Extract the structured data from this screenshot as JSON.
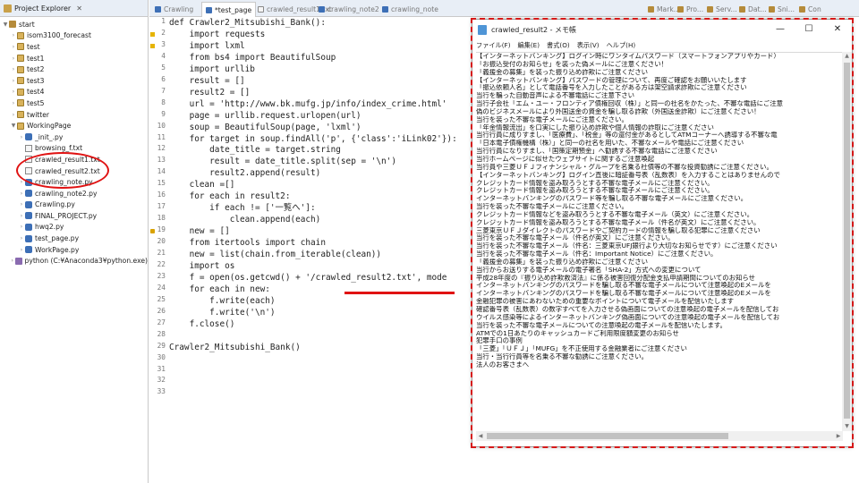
{
  "explorer": {
    "tab_label": "Project Explorer",
    "tree": [
      {
        "label": "start",
        "indent": 0,
        "icon": "project-folder-icon",
        "toggle": "▼"
      },
      {
        "label": "isom3100_forecast",
        "indent": 1,
        "icon": "package-icon",
        "toggle": "›"
      },
      {
        "label": "test",
        "indent": 1,
        "icon": "package-icon",
        "toggle": "›"
      },
      {
        "label": "test1",
        "indent": 1,
        "icon": "package-icon",
        "toggle": "›"
      },
      {
        "label": "test2",
        "indent": 1,
        "icon": "package-icon",
        "toggle": "›"
      },
      {
        "label": "test3",
        "indent": 1,
        "icon": "package-icon",
        "toggle": "›"
      },
      {
        "label": "test4",
        "indent": 1,
        "icon": "package-icon",
        "toggle": "›"
      },
      {
        "label": "test5",
        "indent": 1,
        "icon": "package-icon",
        "toggle": "›"
      },
      {
        "label": "twitter",
        "indent": 1,
        "icon": "package-icon",
        "toggle": "›"
      },
      {
        "label": "WorkingPage",
        "indent": 1,
        "icon": "package-icon",
        "toggle": "▼"
      },
      {
        "label": "_init_.py",
        "indent": 2,
        "icon": "python-file-icon",
        "toggle": "›"
      },
      {
        "label": "browsing_f.txt",
        "indent": 2,
        "icon": "text-file-icon",
        "toggle": ""
      },
      {
        "label": "crawled_result1.txt",
        "indent": 2,
        "icon": "text-file-icon",
        "toggle": ""
      },
      {
        "label": "crawled_result2.txt",
        "indent": 2,
        "icon": "text-file-icon",
        "toggle": ""
      },
      {
        "label": "crawling_note.py",
        "indent": 2,
        "icon": "python-file-icon",
        "toggle": "›"
      },
      {
        "label": "crawling_note2.py",
        "indent": 2,
        "icon": "python-file-icon",
        "toggle": "›"
      },
      {
        "label": "Crawling.py",
        "indent": 2,
        "icon": "python-file-icon",
        "toggle": "›"
      },
      {
        "label": "FINAL_PROJECT.py",
        "indent": 2,
        "icon": "python-file-icon",
        "toggle": "›"
      },
      {
        "label": "hwq2.py",
        "indent": 2,
        "icon": "python-file-icon",
        "toggle": "›"
      },
      {
        "label": "test_page.py",
        "indent": 2,
        "icon": "python-file-icon",
        "toggle": "›"
      },
      {
        "label": "WorkPage.py",
        "indent": 2,
        "icon": "python-file-icon",
        "toggle": "›"
      },
      {
        "label": "python  (C:¥Anaconda3¥python.exe)",
        "indent": 1,
        "icon": "python-interpreter-icon",
        "toggle": "›"
      }
    ]
  },
  "editor": {
    "tabs": [
      {
        "label": "Crawling",
        "active": false,
        "kind": "py"
      },
      {
        "label": "*test_page",
        "active": true,
        "kind": "py"
      },
      {
        "label": "crawled_result1.txt",
        "active": false,
        "kind": "txt"
      },
      {
        "label": "crawling_note2",
        "active": false,
        "kind": "py"
      },
      {
        "label": "crawling_note",
        "active": false,
        "kind": "py"
      },
      {
        "label": "Mark...",
        "active": false,
        "kind": "view"
      },
      {
        "label": "Pro...",
        "active": false,
        "kind": "view"
      },
      {
        "label": "Serv...",
        "active": false,
        "kind": "view"
      },
      {
        "label": "Dat...",
        "active": false,
        "kind": "view"
      },
      {
        "label": "Sni...",
        "active": false,
        "kind": "view"
      },
      {
        "label": "Con",
        "active": false,
        "kind": "view"
      }
    ],
    "lines": [
      {
        "n": "1",
        "code": "def Crawler2_Mitsubishi_Bank():"
      },
      {
        "n": "2",
        "code": "    import requests"
      },
      {
        "n": "3",
        "code": "    import lxml"
      },
      {
        "n": "4",
        "code": "    from bs4 import BeautifulSoup"
      },
      {
        "n": "5",
        "code": "    import urllib"
      },
      {
        "n": "6",
        "code": "    result = []"
      },
      {
        "n": "7",
        "code": "    result2 = []"
      },
      {
        "n": "8",
        "code": "    url = 'http://www.bk.mufg.jp/info/index_crime.html'"
      },
      {
        "n": "9",
        "code": "    page = urllib.request.urlopen(url)"
      },
      {
        "n": "10",
        "code": "    soup = BeautifulSoup(page, 'lxml')"
      },
      {
        "n": "11",
        "code": "    for target in soup.findAll('p', {'class':'iLink02'}):"
      },
      {
        "n": "12",
        "code": "        date_title = target.string"
      },
      {
        "n": "13",
        "code": "        result = date_title.split(sep = '\\n')"
      },
      {
        "n": "14",
        "code": "        result2.append(result)"
      },
      {
        "n": "15",
        "code": "    clean =[]"
      },
      {
        "n": "16",
        "code": "    for each in result2:"
      },
      {
        "n": "17",
        "code": "        if each != ['一覧へ']:"
      },
      {
        "n": "18",
        "code": "            clean.append(each)"
      },
      {
        "n": "19",
        "code": "    new = []"
      },
      {
        "n": "20",
        "code": "    from itertools import chain"
      },
      {
        "n": "21",
        "code": "    new = list(chain.from_iterable(clean))"
      },
      {
        "n": "22",
        "code": "    import os"
      },
      {
        "n": "23",
        "code": "    f = open(os.getcwd() + '/crawled_result2.txt', mode"
      },
      {
        "n": "24",
        "code": "    for each in new:"
      },
      {
        "n": "25",
        "code": "        f.write(each)"
      },
      {
        "n": "26",
        "code": "        f.write('\\n')"
      },
      {
        "n": "27",
        "code": "    f.close()"
      },
      {
        "n": "28",
        "code": ""
      },
      {
        "n": "29",
        "code": "Crawler2_Mitsubishi_Bank()"
      },
      {
        "n": "30",
        "code": ""
      },
      {
        "n": "31",
        "code": ""
      },
      {
        "n": "32",
        "code": ""
      },
      {
        "n": "33",
        "code": ""
      }
    ]
  },
  "notepad": {
    "title": "crawled_result2 - メモ帳",
    "controls": {
      "minimize": "—",
      "maximize": "☐",
      "close": "✕"
    },
    "menu": [
      "ファイル(F)",
      "編集(E)",
      "書式(O)",
      "表示(V)",
      "ヘルプ(H)"
    ],
    "lines": [
      "【インターネットバンキング】ログイン時にワンタイムパスワード（スマートフォンアプリやカード）",
      "「お振込受付のお知らせ」を装った偽メールにご注意ください！",
      "「義援金の募集」を装った振り込め詐欺にご注意ください",
      "【インターネットバンキング】パスワードの管理について、再度ご確認をお願いいたします",
      "「振込依頼人名」として電話番号を入力したことがある方は架空請求詐欺にご注意ください",
      "当行を騙った自動音声による不審電話にご注意下さい",
      "当行子会社「エム・ユー・フロンティア債権回収（株）」と同一の社名をかたった、不審な電話にご注意",
      "偽のビジネスメールにより外国送金の資金を騙し取る詐欺（外国送金詐欺）にご注意ください！",
      "当行を装った不審な電子メールにご注意ください。",
      "「年金情報流出」を口実にした振り込め詐欺や個人情報の詐取にご注意ください",
      "当行行員に成りすまし、「医療費」、「税金」等の還付金があるとしてATMコーナーへ誘導する不審な電",
      "「日本電子債権機構（株）」と同一の社名を用いた、不審なメールや電話にご注意ください",
      "当行行員になりすまし、「国策定期預金」へ勧誘する不審な電話にご注意ください",
      "当行ホームページに似せたウェブサイトに関するご注意喚起",
      "当行員や三菱ＵＦＪフィナンシャル・グループを名乗る社債等の不審な投資勧誘にご注意ください。",
      "【インターネットバンキング】ログイン直後に暗証番号表（乱数表）を入力することはありませんので",
      "クレジットカード情報を盗み取ろうとする不審な電子メールにご注意ください。",
      "クレジットカード情報を盗み取ろうとする不審な電子メールにご注意ください。",
      "インターネットバンキングのパスワード等を騙し取る不審な電子メールにご注意ください。",
      "当行を装った不審な電子メールにご注意ください。",
      "クレジットカード情報などを盗み取ろうとする不審な電子メール（英文）にご注意ください。",
      "クレジットカード情報を盗み取ろうとする不審な電子メール（件名が英文）にご注意ください。",
      "三菱東京ＵＦＪダイレクトのパスワードやご契約カードの情報を騙し取る犯罪にご注意ください",
      "当行を装った不審な電子メール（件名が英文）にご注意ください。",
      "当行を装った不審な電子メール（件名：三菱東京UFJ銀行より大切なお知らせです）にご注意ください",
      "当行を装った不審な電子メール（件名：Important Notice）にご注意ください。",
      "「義援金の募集」を装った振り込め詐欺にご注意ください",
      "当行からお送りする電子メールの電子署名「SHA-2」方式への変更について",
      "平成28年度の『振り込め詐欺救済法』に係る被害回復分配金支払申請期間についてのお知らせ",
      "インターネットバンキングのパスワードを騙し取る不審な電子メールについて注意喚起のEメールを",
      "インターネットバンキングのパスワードを騙し取る不審な電子メールについて注意喚起のEメールを",
      "金融犯罪の被害にあわないための重要なポイントについて電子メールを配信いたします",
      "確認番号表（乱数表）の数字すべてを入力させる偽画面についての注意喚起の電子メールを配信してお",
      "ウイルス感染等によるインターネットバンキング偽画面についての注意喚起の電子メールを配信してお",
      "当行を装った不審な電子メールについての注意喚起の電子メールを配信いたします。",
      "ATMでの1日あたりのキャッシュカードご利用限度額変更のお知らせ",
      "犯罪手口の事例",
      "「三菱」「ＵＦＪ」「MUFG」を不正使用する金融業者にご注意ください",
      "当行・当行行員等を名乗る不審な勧誘にご注意ください。",
      "法人のお客さまへ"
    ]
  },
  "highlight_color": "#e01212"
}
